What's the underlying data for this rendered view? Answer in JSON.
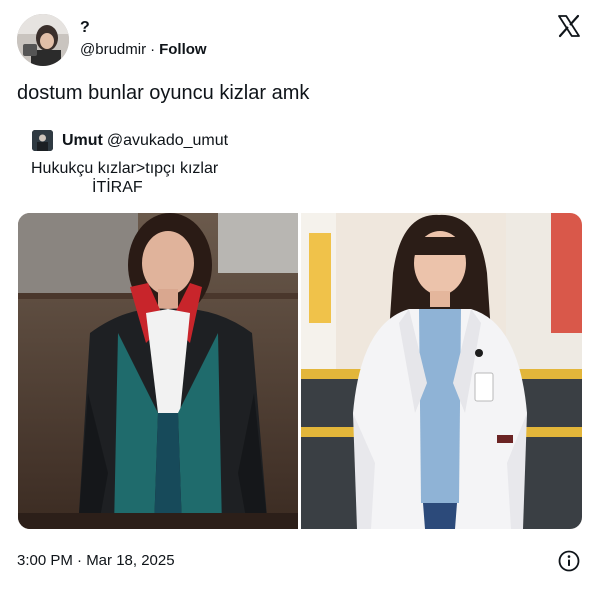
{
  "tweet": {
    "author_name": "?",
    "author_handle": "@brudmir",
    "separator": "·",
    "follow_label": "Follow",
    "text": "dostum bunlar oyuncu kizlar amk",
    "timestamp": "3:00 PM · Mar 18, 2025"
  },
  "quote": {
    "author_name": "Umut",
    "author_handle": "@avukado_umut",
    "line1": "Hukukçu kızlar>tıpçı kızlar",
    "line2": "İTİRAF"
  },
  "media": [
    {
      "icon": "photo-lawyer-woman"
    },
    {
      "icon": "photo-doctor-woman"
    }
  ],
  "icons": {
    "brand": "x-logo-icon",
    "info": "info-icon"
  },
  "colors": {
    "text": "#0f1419",
    "background": "#ffffff"
  }
}
